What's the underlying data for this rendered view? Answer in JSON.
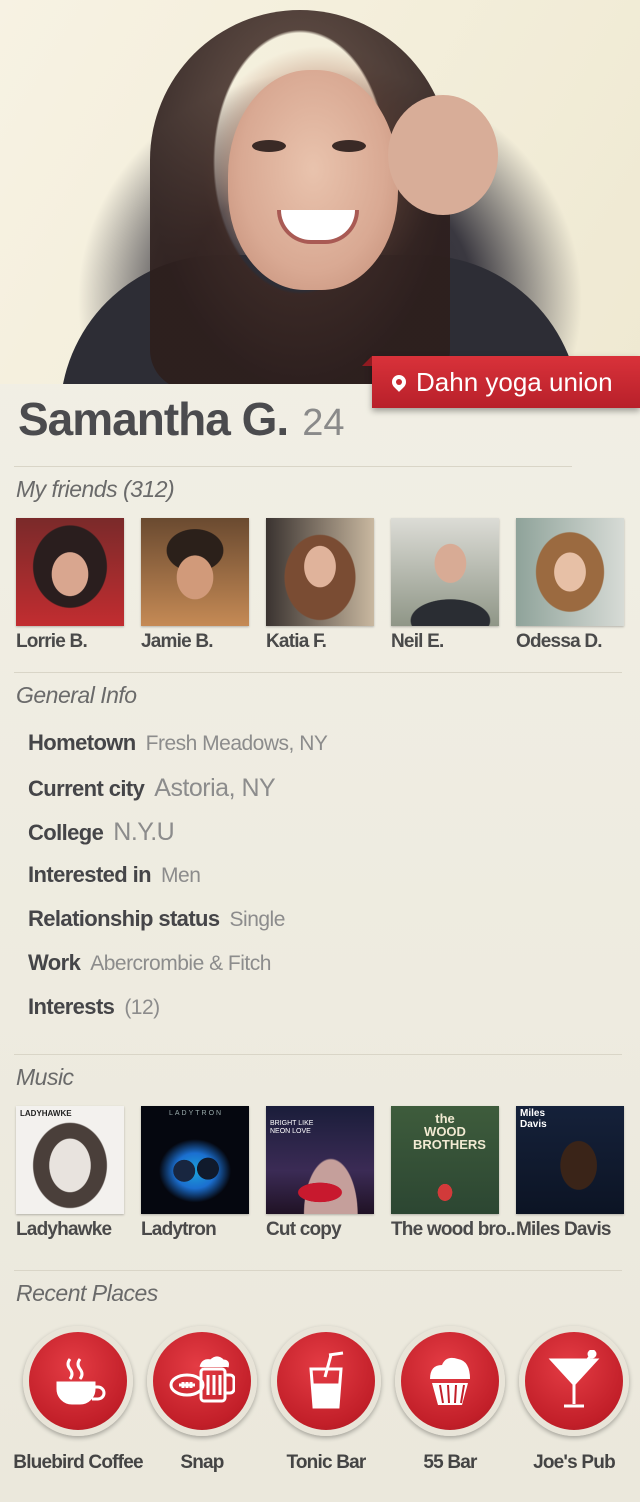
{
  "profile": {
    "name": "Samantha G.",
    "age": "24",
    "current_place": "Dahn yoga union"
  },
  "friends": {
    "title": "My friends (312)",
    "items": [
      {
        "name": "Lorrie B."
      },
      {
        "name": "Jamie B."
      },
      {
        "name": "Katia F."
      },
      {
        "name": "Neil E."
      },
      {
        "name": "Odessa D."
      }
    ]
  },
  "general_info": {
    "title": "General Info",
    "rows": [
      {
        "key": "Hometown",
        "value": "Fresh Meadows, NY"
      },
      {
        "key": "Current city",
        "value": "Astoria, NY"
      },
      {
        "key": "College",
        "value": "N.Y.U"
      },
      {
        "key": "Interested in",
        "value": "Men"
      },
      {
        "key": "Relationship status",
        "value": "Single"
      },
      {
        "key": "Work",
        "value": "Abercrombie & Fitch"
      },
      {
        "key": "Interests",
        "value": "(12)"
      }
    ]
  },
  "music": {
    "title": "Music",
    "items": [
      {
        "name": "Ladyhawke",
        "cover_text": "LADYHAWKE"
      },
      {
        "name": "Ladytron",
        "cover_text": "LADYTRON"
      },
      {
        "name": "Cut copy",
        "cover_text": "BRIGHT LIKE NEON LOVE"
      },
      {
        "name": "The wood bro..",
        "cover_text": "the WOOD BROTHERS"
      },
      {
        "name": "Miles Davis",
        "cover_text": "Miles Davis"
      }
    ]
  },
  "recent_places": {
    "title": "Recent Places",
    "items": [
      {
        "name": "Bluebird Coffee",
        "icon": "coffee-cup-icon"
      },
      {
        "name": "Snap",
        "icon": "beer-football-icon"
      },
      {
        "name": "Tonic Bar",
        "icon": "soda-glass-icon"
      },
      {
        "name": "55 Bar",
        "icon": "cupcake-icon"
      },
      {
        "name": "Joe's Pub",
        "icon": "martini-icon"
      }
    ]
  },
  "colors": {
    "accent_red": "#c8272f",
    "background": "#efece2"
  }
}
